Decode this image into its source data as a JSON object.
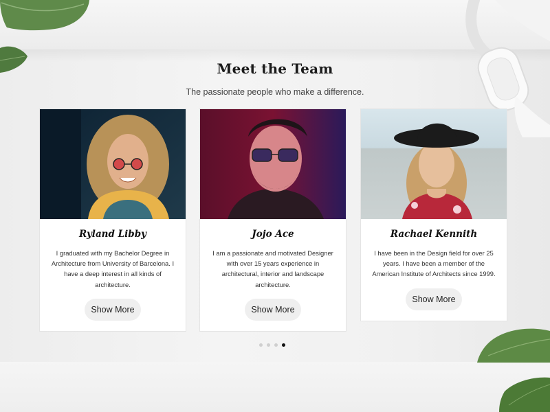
{
  "section": {
    "title": "Meet the Team",
    "subtitle": "The passionate people who make a difference."
  },
  "team": [
    {
      "name": "Ryland Libby",
      "bio": "I graduated with my Bachelor Degree in Architecture from University of Barcelona. I have a deep interest in all kinds of architecture.",
      "button": "Show More"
    },
    {
      "name": "Jojo Ace",
      "bio": "I am a passionate and motivated Designer with over 15 years experience in architectural, interior and landscape architecture.",
      "button": "Show More"
    },
    {
      "name": "Rachael Kennith",
      "bio": "I have been in the Design field for over 25 years. I have been a member of the American Institute of Architects since 1999.",
      "button": "Show More"
    }
  ],
  "pagination": {
    "count": 4,
    "active_index": 3
  },
  "colors": {
    "accent": "#111111",
    "button_bg": "#efefef",
    "card_bg": "#ffffff",
    "dot_inactive": "#cfcfcf"
  },
  "icons": [
    "leaf-decoration-icon",
    "headphones-decoration-icon"
  ]
}
